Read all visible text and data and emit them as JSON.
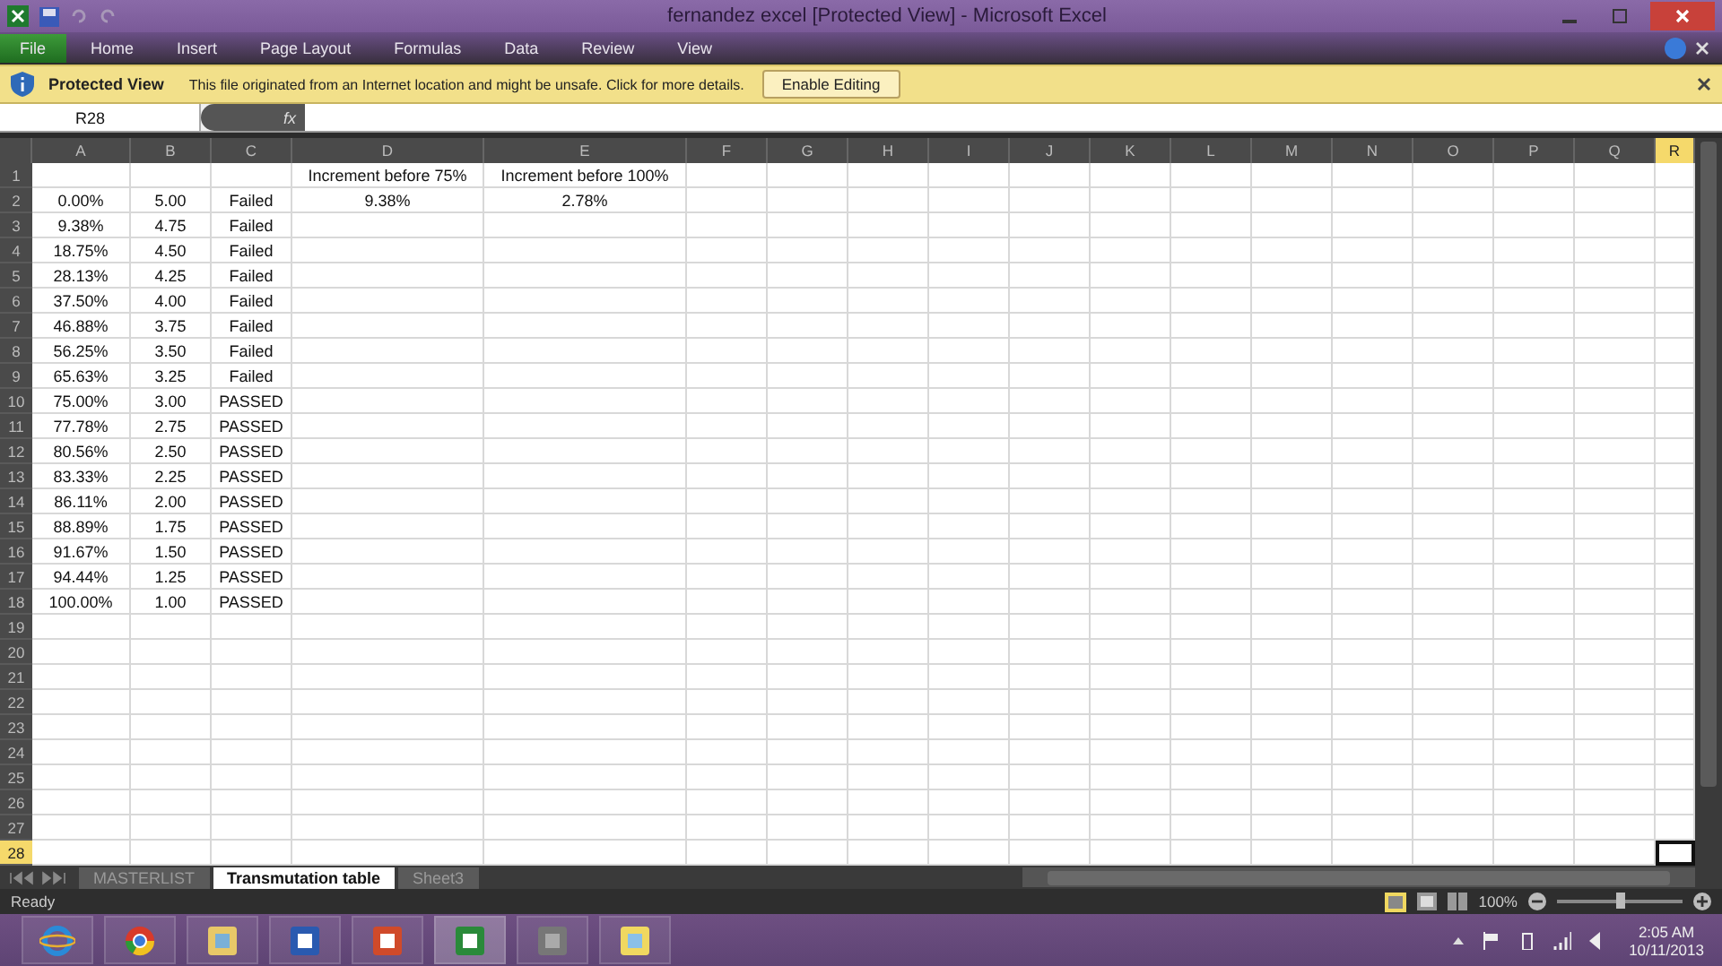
{
  "window": {
    "title": "fernandez excel  [Protected View]  -  Microsoft Excel"
  },
  "ribbon_tabs": [
    {
      "label": "File",
      "kind": "file"
    },
    {
      "label": "Home",
      "kind": "tab"
    },
    {
      "label": "Insert",
      "kind": "tab"
    },
    {
      "label": "Page Layout",
      "kind": "tab"
    },
    {
      "label": "Formulas",
      "kind": "tab"
    },
    {
      "label": "Data",
      "kind": "tab"
    },
    {
      "label": "Review",
      "kind": "tab"
    },
    {
      "label": "View",
      "kind": "tab"
    }
  ],
  "protected_bar": {
    "label": "Protected View",
    "message": "This file originated from an Internet location and might be unsafe. Click for more details.",
    "button": "Enable Editing"
  },
  "name_box": {
    "value": "R28"
  },
  "formula_bar": {
    "fx": "fx"
  },
  "columns": [
    {
      "label": "A",
      "selected": false
    },
    {
      "label": "B",
      "selected": false
    },
    {
      "label": "C",
      "selected": false
    },
    {
      "label": "D",
      "selected": false
    },
    {
      "label": "E",
      "selected": false
    },
    {
      "label": "F",
      "selected": false
    },
    {
      "label": "G",
      "selected": false
    },
    {
      "label": "H",
      "selected": false
    },
    {
      "label": "I",
      "selected": false
    },
    {
      "label": "J",
      "selected": false
    },
    {
      "label": "K",
      "selected": false
    },
    {
      "label": "L",
      "selected": false
    },
    {
      "label": "M",
      "selected": false
    },
    {
      "label": "N",
      "selected": false
    },
    {
      "label": "O",
      "selected": false
    },
    {
      "label": "P",
      "selected": false
    },
    {
      "label": "Q",
      "selected": false
    },
    {
      "label": "R",
      "selected": true
    }
  ],
  "rows": [
    {
      "number": "1",
      "selected": false,
      "cells": {
        "D": "Increment before 75%",
        "E": "Increment before 100%"
      }
    },
    {
      "number": "2",
      "selected": false,
      "cells": {
        "A": "0.00%",
        "B": "5.00",
        "C": "Failed",
        "D": "9.38%",
        "E": "2.78%"
      }
    },
    {
      "number": "3",
      "selected": false,
      "cells": {
        "A": "9.38%",
        "B": "4.75",
        "C": "Failed"
      }
    },
    {
      "number": "4",
      "selected": false,
      "cells": {
        "A": "18.75%",
        "B": "4.50",
        "C": "Failed"
      }
    },
    {
      "number": "5",
      "selected": false,
      "cells": {
        "A": "28.13%",
        "B": "4.25",
        "C": "Failed"
      }
    },
    {
      "number": "6",
      "selected": false,
      "cells": {
        "A": "37.50%",
        "B": "4.00",
        "C": "Failed"
      }
    },
    {
      "number": "7",
      "selected": false,
      "cells": {
        "A": "46.88%",
        "B": "3.75",
        "C": "Failed"
      }
    },
    {
      "number": "8",
      "selected": false,
      "cells": {
        "A": "56.25%",
        "B": "3.50",
        "C": "Failed"
      }
    },
    {
      "number": "9",
      "selected": false,
      "cells": {
        "A": "65.63%",
        "B": "3.25",
        "C": "Failed"
      }
    },
    {
      "number": "10",
      "selected": false,
      "cells": {
        "A": "75.00%",
        "B": "3.00",
        "C": "PASSED"
      }
    },
    {
      "number": "11",
      "selected": false,
      "cells": {
        "A": "77.78%",
        "B": "2.75",
        "C": "PASSED"
      }
    },
    {
      "number": "12",
      "selected": false,
      "cells": {
        "A": "80.56%",
        "B": "2.50",
        "C": "PASSED"
      }
    },
    {
      "number": "13",
      "selected": false,
      "cells": {
        "A": "83.33%",
        "B": "2.25",
        "C": "PASSED"
      }
    },
    {
      "number": "14",
      "selected": false,
      "cells": {
        "A": "86.11%",
        "B": "2.00",
        "C": "PASSED"
      }
    },
    {
      "number": "15",
      "selected": false,
      "cells": {
        "A": "88.89%",
        "B": "1.75",
        "C": "PASSED"
      }
    },
    {
      "number": "16",
      "selected": false,
      "cells": {
        "A": "91.67%",
        "B": "1.50",
        "C": "PASSED"
      }
    },
    {
      "number": "17",
      "selected": false,
      "cells": {
        "A": "94.44%",
        "B": "1.25",
        "C": "PASSED"
      }
    },
    {
      "number": "18",
      "selected": false,
      "cells": {
        "A": "100.00%",
        "B": "1.00",
        "C": "PASSED"
      }
    },
    {
      "number": "19",
      "selected": false,
      "cells": {}
    },
    {
      "number": "20",
      "selected": false,
      "cells": {}
    },
    {
      "number": "21",
      "selected": false,
      "cells": {}
    },
    {
      "number": "22",
      "selected": false,
      "cells": {}
    },
    {
      "number": "23",
      "selected": false,
      "cells": {}
    },
    {
      "number": "24",
      "selected": false,
      "cells": {}
    },
    {
      "number": "25",
      "selected": false,
      "cells": {}
    },
    {
      "number": "26",
      "selected": false,
      "cells": {}
    },
    {
      "number": "27",
      "selected": false,
      "cells": {}
    },
    {
      "number": "28",
      "selected": true,
      "cells": {}
    }
  ],
  "sheet_tabs": [
    {
      "label": "MASTERLIST",
      "selected": false
    },
    {
      "label": "Transmutation table",
      "selected": true
    },
    {
      "label": "Sheet3",
      "selected": false
    }
  ],
  "status_bar": {
    "status": "Ready",
    "zoom": "100%",
    "zoom_slider": {
      "level": 0.5
    }
  },
  "taskbar": {
    "time": "2:05 AM",
    "date": "10/11/2013"
  }
}
